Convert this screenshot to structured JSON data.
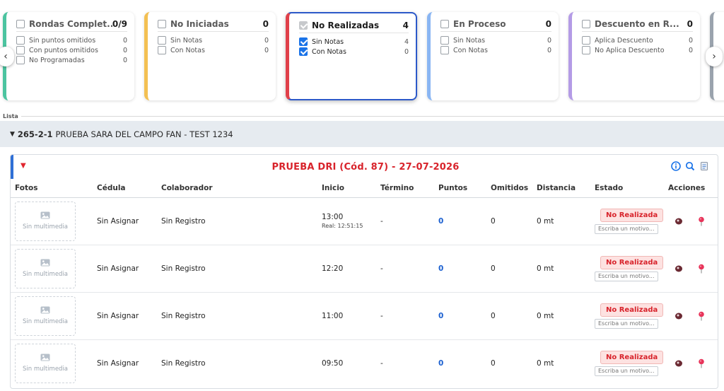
{
  "cards": [
    {
      "title": "Rondas Complet...",
      "count": "0/9",
      "color": "#4cc4a0",
      "active": false,
      "rows": [
        {
          "label": "Sin puntos omitidos",
          "value": "0"
        },
        {
          "label": "Con puntos omitidos",
          "value": "0"
        },
        {
          "label": "No Programadas",
          "value": "0"
        }
      ]
    },
    {
      "title": "No Iniciadas",
      "count": "0",
      "color": "#f3c052",
      "active": false,
      "rows": [
        {
          "label": "Sin Notas",
          "value": "0"
        },
        {
          "label": "Con Notas",
          "value": "0"
        }
      ]
    },
    {
      "title": "No Realizadas",
      "count": "4",
      "color": "#e0404a",
      "active": true,
      "rows": [
        {
          "label": "Sin Notas",
          "value": "4"
        },
        {
          "label": "Con Notas",
          "value": "0"
        }
      ]
    },
    {
      "title": "En Proceso",
      "count": "0",
      "color": "#8ab6f3",
      "active": false,
      "rows": [
        {
          "label": "Sin Notas",
          "value": "0"
        },
        {
          "label": "Con Notas",
          "value": "0"
        }
      ]
    },
    {
      "title": "Descuento en R...",
      "count": "0",
      "color": "#b49be6",
      "active": false,
      "rows": [
        {
          "label": "Aplica Descuento",
          "value": "0"
        },
        {
          "label": "No Aplica Descuento",
          "value": "0"
        }
      ]
    }
  ],
  "lista_label": "Lista",
  "group": {
    "code": "265-2-1",
    "name": "PRUEBA SARA DEL CAMPO FAN - TEST 1234"
  },
  "panel": {
    "title": "PRUEBA DRI (Cód. 87) - 27-07-2026",
    "columns": [
      "Fotos",
      "Cédula",
      "Colaborador",
      "Inicio",
      "Término",
      "Puntos",
      "Omitidos",
      "Distancia",
      "Estado",
      "Acciones"
    ],
    "rows": [
      {
        "foto": "Sin multimedia",
        "cedula": "Sin Asignar",
        "colaborador": "Sin Registro",
        "inicio": "13:00",
        "real": "Real: 12:51:15",
        "termino": "-",
        "puntos": "0",
        "omitidos": "0",
        "distancia": "0 mt",
        "estado": "No Realizada",
        "motivo_placeholder": "Escriba un motivo..."
      },
      {
        "foto": "Sin multimedia",
        "cedula": "Sin Asignar",
        "colaborador": "Sin Registro",
        "inicio": "12:20",
        "real": "",
        "termino": "-",
        "puntos": "0",
        "omitidos": "0",
        "distancia": "0 mt",
        "estado": "No Realizada",
        "motivo_placeholder": "Escriba un motivo..."
      },
      {
        "foto": "Sin multimedia",
        "cedula": "Sin Asignar",
        "colaborador": "Sin Registro",
        "inicio": "11:00",
        "real": "",
        "termino": "-",
        "puntos": "0",
        "omitidos": "0",
        "distancia": "0 mt",
        "estado": "No Realizada",
        "motivo_placeholder": "Escriba un motivo..."
      },
      {
        "foto": "Sin multimedia",
        "cedula": "Sin Asignar",
        "colaborador": "Sin Registro",
        "inicio": "09:50",
        "real": "",
        "termino": "-",
        "puntos": "0",
        "omitidos": "0",
        "distancia": "0 mt",
        "estado": "No Realizada",
        "motivo_placeholder": "Escriba un motivo..."
      }
    ]
  },
  "nav": {
    "left": "‹",
    "right": "›"
  },
  "icons": {
    "info": "info-icon",
    "zoom": "zoom-icon",
    "document": "document-icon",
    "eye": "eye-icon",
    "pin": "map-pin-icon",
    "image": "image-icon"
  }
}
